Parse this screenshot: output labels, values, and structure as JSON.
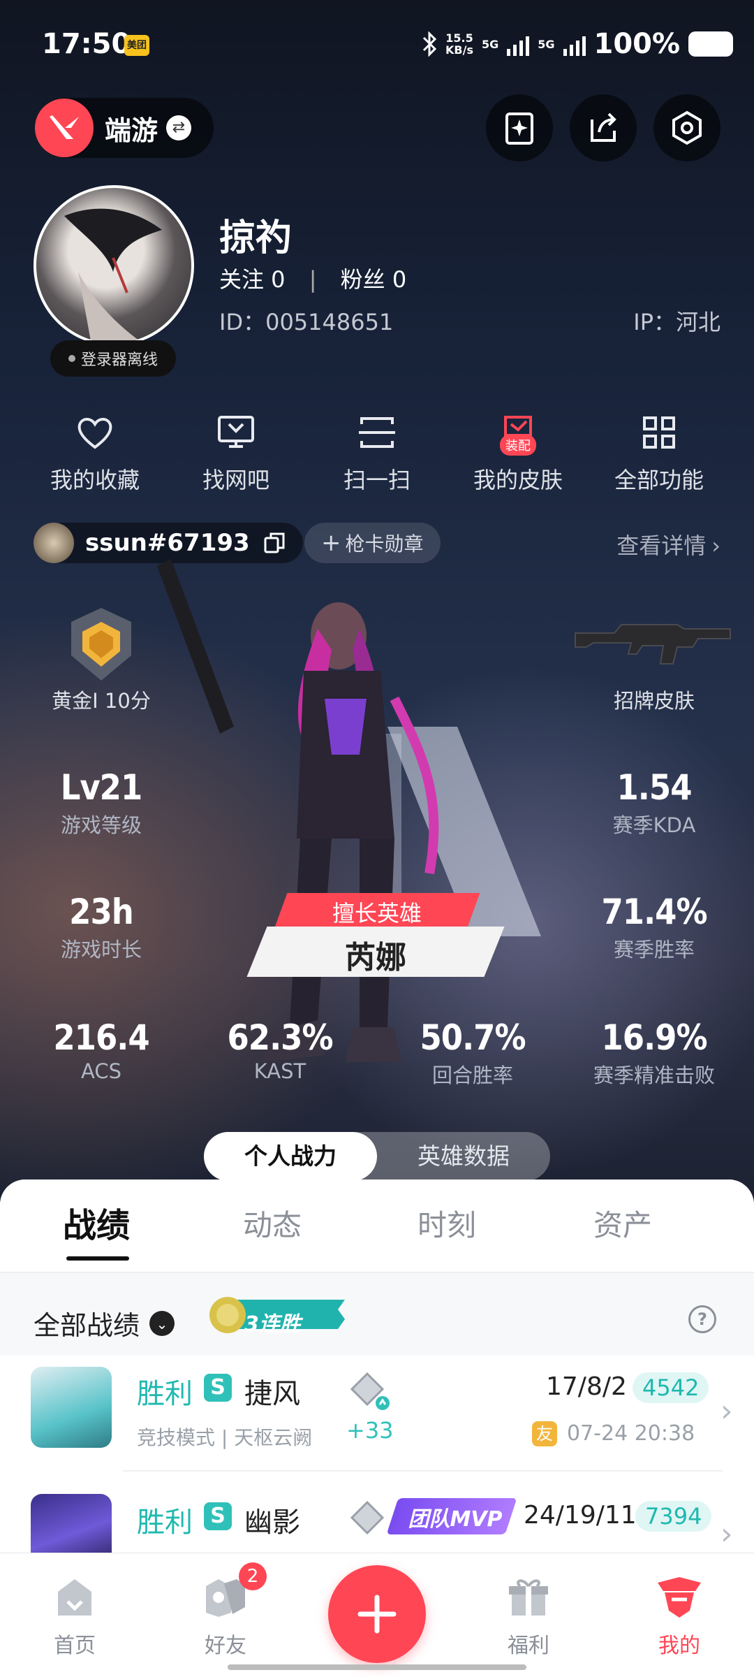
{
  "status_bar": {
    "time": "17:50",
    "app_badge": "美团",
    "net_speed": "15.5",
    "net_unit": "KB/s",
    "sim1": "5G",
    "sim2": "5G",
    "battery": "100%"
  },
  "header": {
    "brand": "端游"
  },
  "profile": {
    "name": "掠礿",
    "follow": "关注 0",
    "fans": "粉丝 0",
    "id": "ID：005148651",
    "ip": "IP：河北",
    "status": "登录器离线"
  },
  "quick_actions": [
    {
      "label": "我的收藏",
      "icon": "heart-icon"
    },
    {
      "label": "找网吧",
      "icon": "monitor-icon"
    },
    {
      "label": "扫一扫",
      "icon": "scan-icon"
    },
    {
      "label": "我的皮肤",
      "icon": "skin-icon",
      "badge": "装配"
    },
    {
      "label": "全部功能",
      "icon": "grid-icon"
    }
  ],
  "game": {
    "riot_id": "ssun#67193",
    "medal_label": "枪卡勋章",
    "detail_link": "查看详情"
  },
  "stats": {
    "rank": "黄金I 10分",
    "skin": "招牌皮肤",
    "level_v": "Lv21",
    "level_k": "游戏等级",
    "kda_v": "1.54",
    "kda_k": "赛季KDA",
    "hours_v": "23h",
    "hours_k": "游戏时长",
    "winrate_v": "71.4%",
    "winrate_k": "赛季胜率",
    "acs_v": "216.4",
    "acs_k": "ACS",
    "kast_v": "62.3%",
    "kast_k": "KAST",
    "round_v": "50.7%",
    "round_k": "回合胜率",
    "hs_v": "16.9%",
    "hs_k": "赛季精准击败"
  },
  "hero": {
    "tag": "擅长英雄",
    "name": "芮娜"
  },
  "toggle": {
    "personal": "个人战力",
    "hero_data": "英雄数据"
  },
  "tabs": [
    "战绩",
    "动态",
    "时刻",
    "资产"
  ],
  "filter": {
    "label": "全部战绩",
    "streak": "3连胜"
  },
  "matches": [
    {
      "result": "胜利",
      "mode_badge": "S",
      "agent": "捷风",
      "mode": "竞技模式 | 天枢云阙",
      "delta": "+33",
      "kda": "17/8/2",
      "score": "4542",
      "friend": "友",
      "time": "07-24 20:38"
    },
    {
      "result": "胜利",
      "mode_badge": "S",
      "agent": "幽影",
      "mvp": "团队MVP",
      "kda": "24/19/11",
      "score": "7394"
    }
  ],
  "nav": [
    {
      "label": "首页",
      "icon": "home-icon"
    },
    {
      "label": "好友",
      "icon": "friends-icon",
      "badge": "2"
    },
    {
      "label": "福利",
      "icon": "gift-icon"
    },
    {
      "label": "我的",
      "icon": "profile-icon"
    }
  ],
  "colors": {
    "accent": "#ff4655",
    "win": "#1fb8b0"
  }
}
